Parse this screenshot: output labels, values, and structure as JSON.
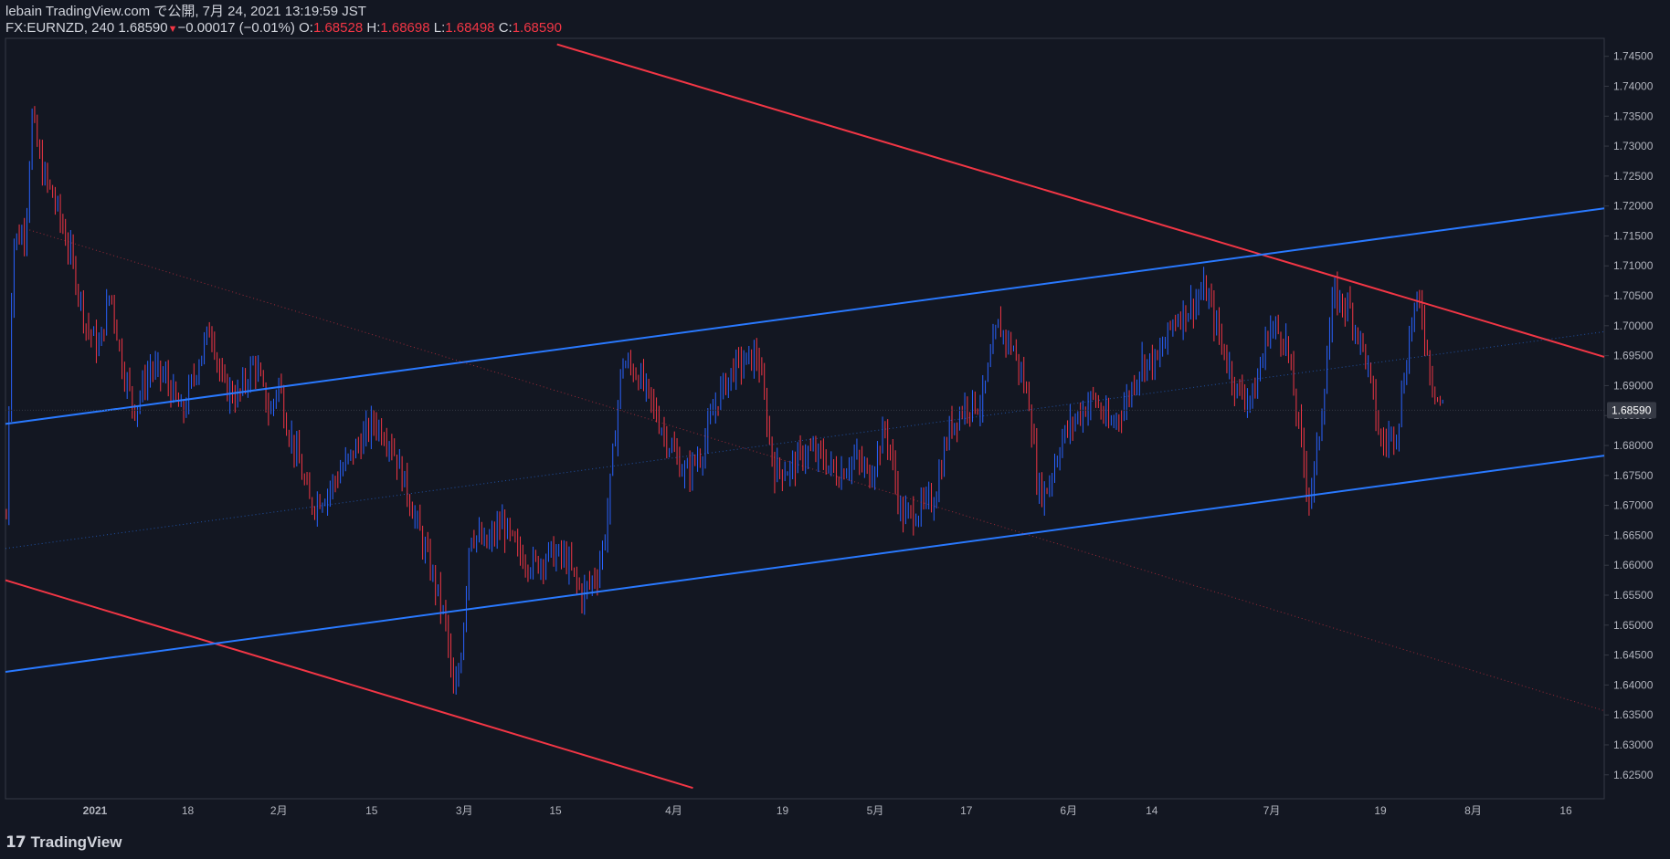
{
  "header": {
    "publish_line": "lebain TradingView.com で公開, 7月 24, 2021 13:19:59 JST",
    "symbol": "FX:EURNZD, 240",
    "last": "1.68590",
    "change": "−0.00017 (−0.01%)",
    "o_label": "O:",
    "o_value": "1.68528",
    "h_label": "H:",
    "h_value": "1.68698",
    "l_label": "L:",
    "l_value": "1.68498",
    "c_label": "C:",
    "c_value": "1.68590"
  },
  "footer": {
    "brand": "TradingView",
    "logo_icon": "tradingview-logo-icon"
  },
  "colors": {
    "background": "#131722",
    "up": "#2962ff",
    "down": "#f23645",
    "red_line": "#f23645",
    "blue_line": "#2979ff",
    "text": "#d1d4dc",
    "grid_border": "#363a45"
  },
  "chart_data": {
    "type": "candlestick",
    "symbol": "FX:EURNZD",
    "interval": "240",
    "y_axis_ticks": [
      "1.62500",
      "1.63000",
      "1.63500",
      "1.64000",
      "1.64500",
      "1.65000",
      "1.65500",
      "1.66000",
      "1.66500",
      "1.67000",
      "1.67500",
      "1.68000",
      "1.68500",
      "1.69000",
      "1.69500",
      "1.70000",
      "1.70500",
      "1.71000",
      "1.71500",
      "1.72000",
      "1.72500",
      "1.73000",
      "1.73500",
      "1.74000",
      "1.74500"
    ],
    "ylim": [
      1.621,
      1.748
    ],
    "x_axis_ticks": [
      "2021",
      "18",
      "2月",
      "15",
      "3月",
      "15",
      "4月",
      "19",
      "5月",
      "17",
      "6月",
      "14",
      "7月",
      "19",
      "8月",
      "16"
    ],
    "last_price_label": "1.68590",
    "price_path": [
      [
        0,
        1.668
      ],
      [
        0.004,
        1.714
      ],
      [
        0.012,
        1.716
      ],
      [
        0.016,
        1.735
      ],
      [
        0.022,
        1.726
      ],
      [
        0.03,
        1.721
      ],
      [
        0.04,
        1.712
      ],
      [
        0.05,
        1.7
      ],
      [
        0.058,
        1.696
      ],
      [
        0.065,
        1.706
      ],
      [
        0.072,
        1.694
      ],
      [
        0.08,
        1.686
      ],
      [
        0.09,
        1.693
      ],
      [
        0.1,
        1.691
      ],
      [
        0.11,
        1.685
      ],
      [
        0.12,
        1.694
      ],
      [
        0.128,
        1.7
      ],
      [
        0.135,
        1.69
      ],
      [
        0.145,
        1.688
      ],
      [
        0.155,
        1.694
      ],
      [
        0.165,
        1.685
      ],
      [
        0.17,
        1.691
      ],
      [
        0.175,
        1.684
      ],
      [
        0.182,
        1.678
      ],
      [
        0.19,
        1.67
      ],
      [
        0.2,
        1.672
      ],
      [
        0.21,
        1.676
      ],
      [
        0.22,
        1.68
      ],
      [
        0.23,
        1.684
      ],
      [
        0.24,
        1.681
      ],
      [
        0.25,
        1.673
      ],
      [
        0.26,
        1.664
      ],
      [
        0.268,
        1.657
      ],
      [
        0.275,
        1.65
      ],
      [
        0.28,
        1.637
      ],
      [
        0.285,
        1.647
      ],
      [
        0.29,
        1.666
      ],
      [
        0.3,
        1.663
      ],
      [
        0.31,
        1.667
      ],
      [
        0.32,
        1.662
      ],
      [
        0.33,
        1.66
      ],
      [
        0.34,
        1.662
      ],
      [
        0.35,
        1.661
      ],
      [
        0.36,
        1.655
      ],
      [
        0.37,
        1.659
      ],
      [
        0.375,
        1.666
      ],
      [
        0.385,
        1.694
      ],
      [
        0.395,
        1.692
      ],
      [
        0.405,
        1.686
      ],
      [
        0.415,
        1.68
      ],
      [
        0.425,
        1.675
      ],
      [
        0.435,
        1.679
      ],
      [
        0.445,
        1.688
      ],
      [
        0.455,
        1.693
      ],
      [
        0.47,
        1.695
      ],
      [
        0.48,
        1.676
      ],
      [
        0.49,
        1.676
      ],
      [
        0.5,
        1.679
      ],
      [
        0.51,
        1.678
      ],
      [
        0.52,
        1.675
      ],
      [
        0.53,
        1.678
      ],
      [
        0.54,
        1.675
      ],
      [
        0.55,
        1.683
      ],
      [
        0.56,
        1.668
      ],
      [
        0.57,
        1.669
      ],
      [
        0.58,
        1.671
      ],
      [
        0.59,
        1.683
      ],
      [
        0.6,
        1.687
      ],
      [
        0.61,
        1.687
      ],
      [
        0.62,
        1.7
      ],
      [
        0.63,
        1.696
      ],
      [
        0.64,
        1.687
      ],
      [
        0.645,
        1.673
      ],
      [
        0.65,
        1.672
      ],
      [
        0.66,
        1.681
      ],
      [
        0.67,
        1.685
      ],
      [
        0.68,
        1.688
      ],
      [
        0.69,
        1.683
      ],
      [
        0.7,
        1.687
      ],
      [
        0.71,
        1.694
      ],
      [
        0.72,
        1.694
      ],
      [
        0.73,
        1.701
      ],
      [
        0.74,
        1.703
      ],
      [
        0.75,
        1.706
      ],
      [
        0.76,
        1.697
      ],
      [
        0.77,
        1.689
      ],
      [
        0.78,
        1.688
      ],
      [
        0.79,
        1.7
      ],
      [
        0.8,
        1.698
      ],
      [
        0.81,
        1.68
      ],
      [
        0.815,
        1.671
      ],
      [
        0.82,
        1.679
      ],
      [
        0.83,
        1.705
      ],
      [
        0.84,
        1.703
      ],
      [
        0.85,
        1.695
      ],
      [
        0.86,
        1.68
      ],
      [
        0.87,
        1.683
      ],
      [
        0.88,
        1.703
      ],
      [
        0.885,
        1.703
      ],
      [
        0.89,
        1.693
      ],
      [
        0.895,
        1.688
      ],
      [
        0.9,
        1.686
      ]
    ],
    "trendlines": [
      {
        "color": "red",
        "from": [
          0.345,
          1.747
        ],
        "to": [
          1.0,
          1.6948
        ]
      },
      {
        "color": "red",
        "from": [
          0.0,
          1.6575
        ],
        "to": [
          0.43,
          1.6228
        ]
      },
      {
        "color": "blue",
        "from": [
          0.0,
          1.6836
        ],
        "to": [
          1.0,
          1.7196
        ]
      },
      {
        "color": "blue",
        "from": [
          0.0,
          1.6422
        ],
        "to": [
          1.0,
          1.6783
        ]
      },
      {
        "color": "red-dotted",
        "from": [
          0.015,
          1.716
        ],
        "to": [
          1.0,
          1.6357
        ]
      },
      {
        "color": "blue-dotted",
        "from": [
          0.0,
          1.6628
        ],
        "to": [
          1.0,
          1.699
        ]
      }
    ]
  }
}
